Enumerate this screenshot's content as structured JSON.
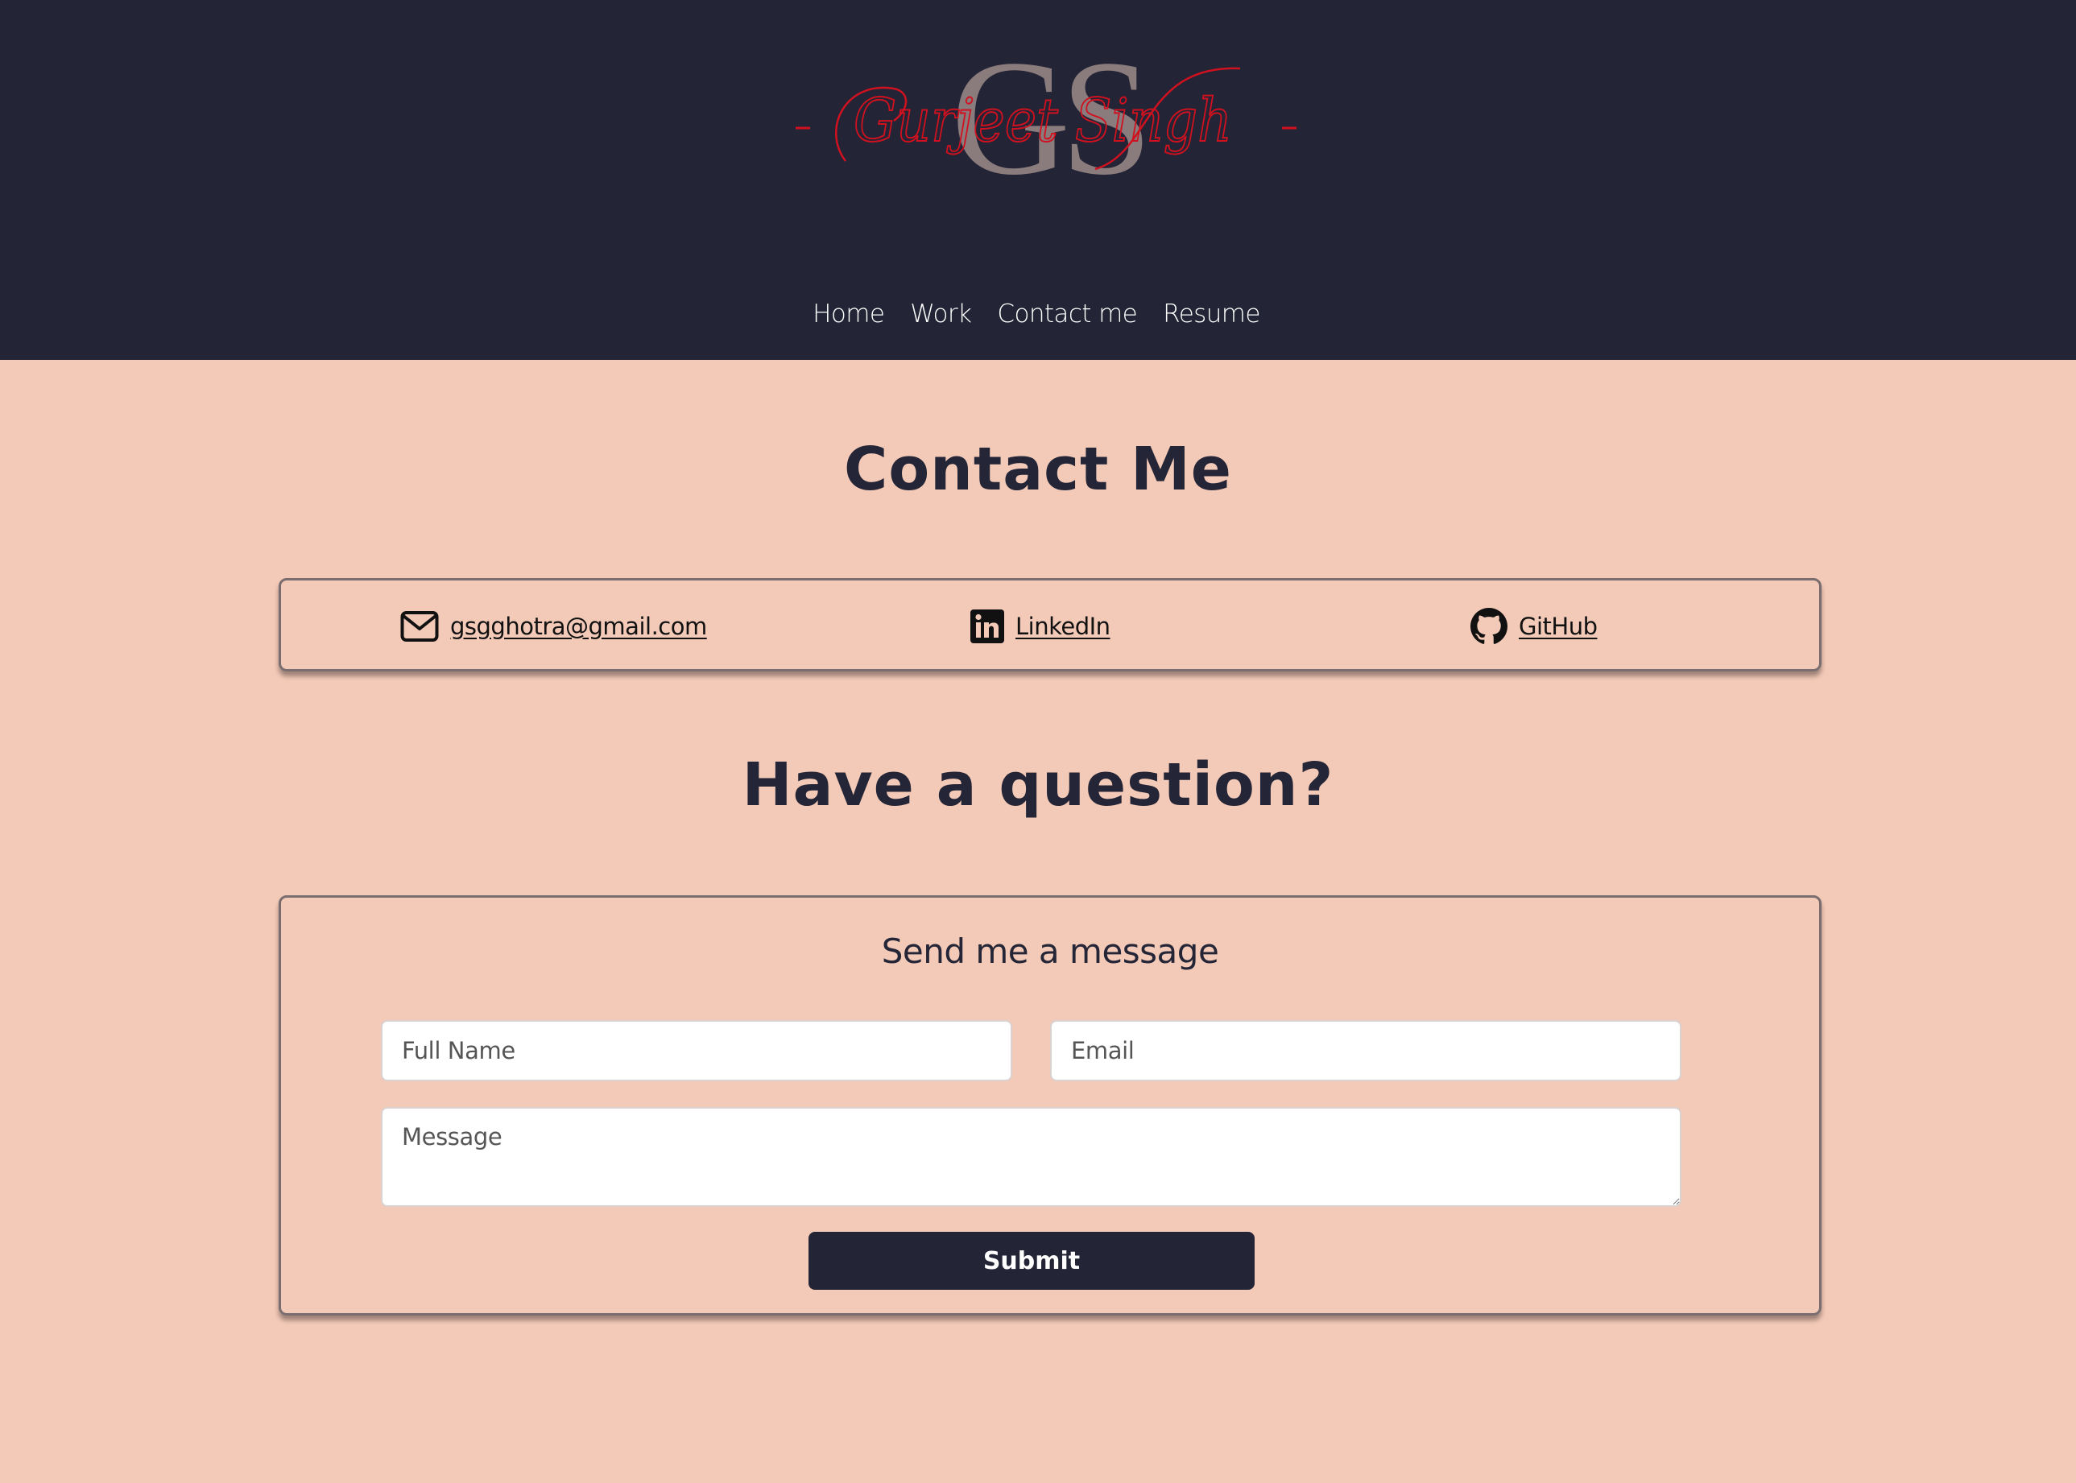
{
  "colors": {
    "header_bg": "#232435",
    "page_bg": "#f3c9b7",
    "accent_red": "#d0111f",
    "monogram_gray": "#8a7b7d",
    "text_dark": "#242536"
  },
  "logo": {
    "monogram": "GS",
    "signature": "Gurjeet Singh"
  },
  "nav": {
    "items": [
      {
        "label": "Home"
      },
      {
        "label": "Work"
      },
      {
        "label": "Contact me"
      },
      {
        "label": "Resume"
      }
    ]
  },
  "contact": {
    "heading": "Contact Me",
    "email": {
      "label": "gsgghotra@gmail.com",
      "icon": "envelope-icon"
    },
    "linkedin": {
      "label": "LinkedIn",
      "icon": "linkedin-icon"
    },
    "github": {
      "label": "GitHub",
      "icon": "github-icon"
    }
  },
  "question": {
    "heading": "Have a question?"
  },
  "form": {
    "title": "Send me a message",
    "name_placeholder": "Full Name",
    "email_placeholder": "Email",
    "message_placeholder": "Message",
    "submit_label": "Submit"
  }
}
